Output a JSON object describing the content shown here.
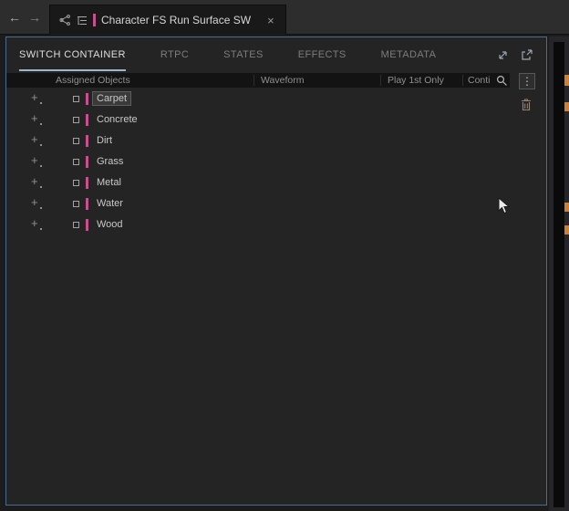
{
  "titlebar": {
    "back_label": "←",
    "forward_label": "→",
    "tab": {
      "title": "Character FS Run Surface SW",
      "close_label": "×"
    }
  },
  "panel": {
    "tabs": [
      {
        "label": "SWITCH CONTAINER"
      },
      {
        "label": "RTPC"
      },
      {
        "label": "STATES"
      },
      {
        "label": "EFFECTS"
      },
      {
        "label": "METADATA"
      }
    ],
    "header": {
      "columns": [
        "Assigned Objects",
        "Waveform",
        "Play 1st Only",
        "Conti"
      ]
    },
    "rows": [
      {
        "name": "Carpet"
      },
      {
        "name": "Concrete"
      },
      {
        "name": "Dirt"
      },
      {
        "name": "Grass"
      },
      {
        "name": "Metal"
      },
      {
        "name": "Water"
      },
      {
        "name": "Wood"
      }
    ],
    "menu_glyph": "⋮"
  },
  "icons": {
    "add": "+"
  },
  "colors": {
    "accent_pink": "#c9508e",
    "marker_orange": "#c8823c"
  }
}
